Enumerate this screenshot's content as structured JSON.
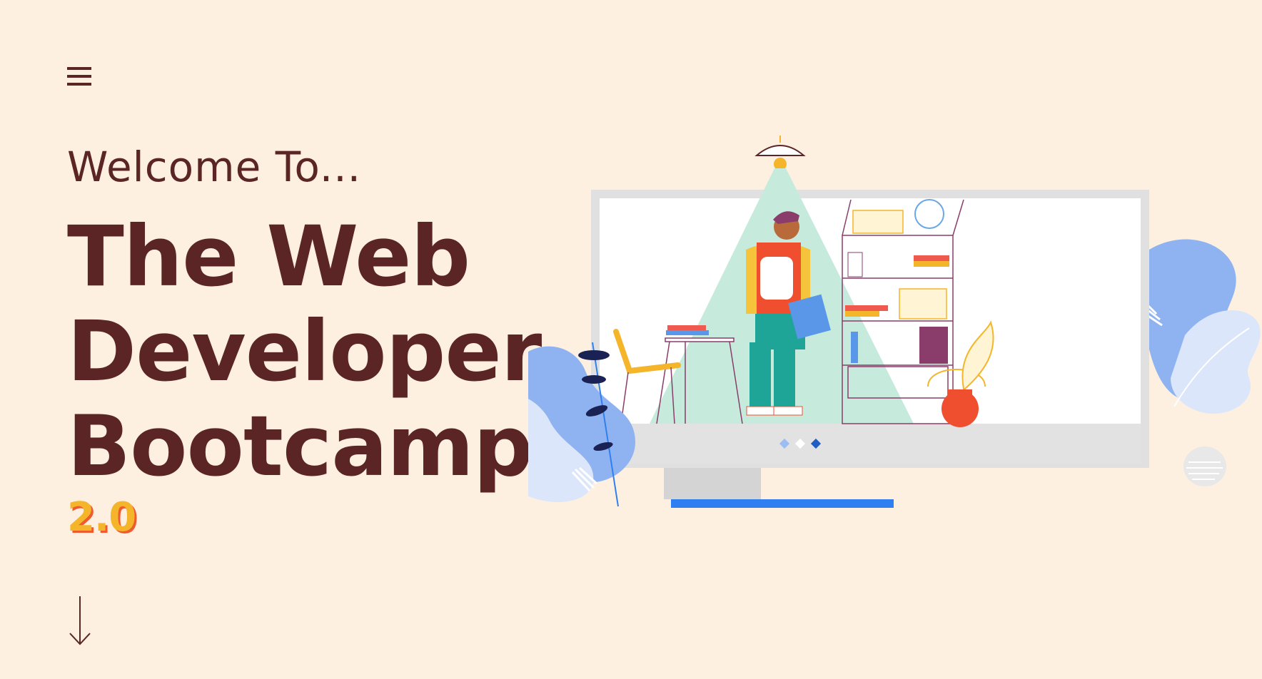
{
  "header": {
    "menu_icon": "hamburger-menu-icon"
  },
  "hero": {
    "welcome": "Welcome To...",
    "title_lines": [
      "The Web",
      "Developer",
      "Bootcamp"
    ],
    "version": "2.0",
    "scroll_icon": "arrow-down-icon"
  },
  "colors": {
    "background": "#fdf0e0",
    "text": "#5a2524",
    "accent_yellow": "#f5b52a",
    "accent_orange": "#ef5a2f",
    "accent_blue": "#2f7ff0"
  },
  "carousel": {
    "dot_count": 3,
    "active_index": 2
  }
}
